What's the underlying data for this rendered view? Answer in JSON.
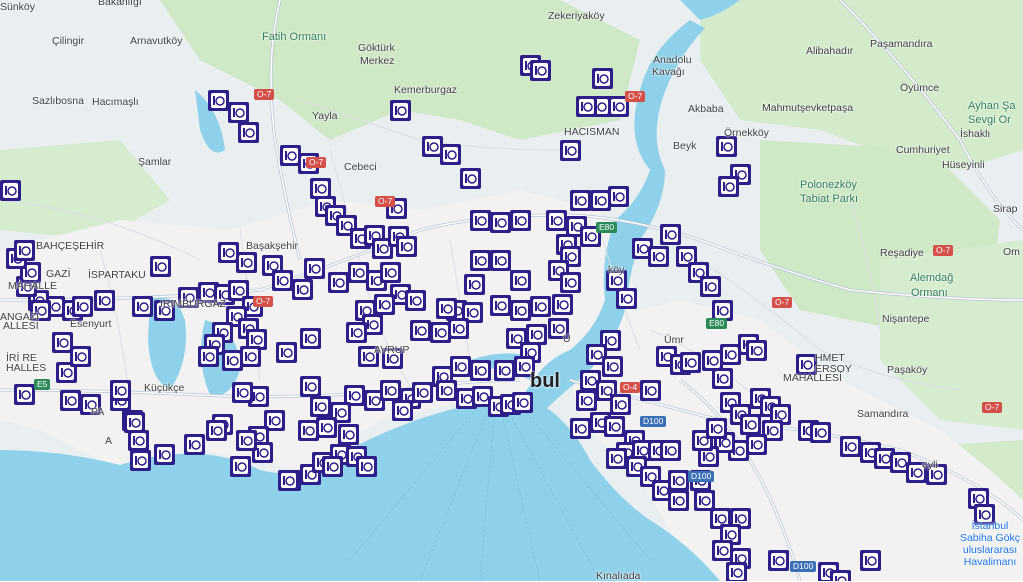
{
  "map": {
    "colors": {
      "land": "#e9eef0",
      "forest": "#cfe8c5",
      "water": "#8fd1ea",
      "urban": "#f3f3f3",
      "marker": "#2c1f8a"
    },
    "places": [
      {
        "id": "sunkoy",
        "text": "Sünköy",
        "cls": "place"
      },
      {
        "id": "bakanligi",
        "text": "Bakanlığı",
        "cls": "place"
      },
      {
        "id": "cilingir",
        "text": "Çilingir",
        "cls": "place"
      },
      {
        "id": "arnavutkoy",
        "text": "Arnavutköy",
        "cls": "place"
      },
      {
        "id": "fatih-ormani",
        "text": "Fatih Ormanı",
        "cls": "place green"
      },
      {
        "id": "gokturk",
        "text": "Göktürk",
        "cls": "place"
      },
      {
        "id": "merkez",
        "text": "Merkez",
        "cls": "place"
      },
      {
        "id": "zekeriyakoy",
        "text": "Zekeriyaköy",
        "cls": "place"
      },
      {
        "id": "anadolu-kavagi",
        "text": "Anadolu",
        "cls": "place"
      },
      {
        "id": "kavagi",
        "text": "Kavağı",
        "cls": "place"
      },
      {
        "id": "alibahadir",
        "text": "Alibahadır",
        "cls": "place"
      },
      {
        "id": "pasamandira",
        "text": "Paşamandıra",
        "cls": "place"
      },
      {
        "id": "sazlibosna",
        "text": "Sazlıbosna",
        "cls": "place"
      },
      {
        "id": "hacimasli",
        "text": "Hacımaşlı",
        "cls": "place"
      },
      {
        "id": "kemerburgaz",
        "text": "Kemerburgaz",
        "cls": "place"
      },
      {
        "id": "akbaba",
        "text": "Akbaba",
        "cls": "place"
      },
      {
        "id": "mahmutsevketpasa",
        "text": "Mahmutşevketpaşa",
        "cls": "place"
      },
      {
        "id": "oyumce",
        "text": "Öyümce",
        "cls": "place"
      },
      {
        "id": "ayhan-sa",
        "text": "Ayhan Şa",
        "cls": "place green"
      },
      {
        "id": "sevgi-or",
        "text": "Sevgi Or",
        "cls": "place green"
      },
      {
        "id": "ishakli",
        "text": "İshaklı",
        "cls": "place"
      },
      {
        "id": "yayla",
        "text": "Yayla",
        "cls": "place"
      },
      {
        "id": "hacisman",
        "text": "HACISMAN",
        "cls": "place"
      },
      {
        "id": "beyk",
        "text": "Beyk",
        "cls": "place"
      },
      {
        "id": "ornekkoy",
        "text": "Örnekköy",
        "cls": "place"
      },
      {
        "id": "cumhuriyet",
        "text": "Cumhuriyet",
        "cls": "place"
      },
      {
        "id": "huseyinli",
        "text": "Hüseyinli",
        "cls": "place"
      },
      {
        "id": "samlar",
        "text": "Şamlar",
        "cls": "place"
      },
      {
        "id": "cebeci",
        "text": "Cebeci",
        "cls": "place"
      },
      {
        "id": "polonezkoy",
        "text": "Polonezköy",
        "cls": "place green"
      },
      {
        "id": "tabiat-parki",
        "text": "Tabiat Parkı",
        "cls": "place green"
      },
      {
        "id": "sirap",
        "text": "Sirap",
        "cls": "place"
      },
      {
        "id": "bahcesehir",
        "text": "BAHÇEŞEHİR",
        "cls": "place"
      },
      {
        "id": "basaksehir",
        "text": "Başakşehir",
        "cls": "place"
      },
      {
        "id": "resadiye",
        "text": "Reşadiye",
        "cls": "place"
      },
      {
        "id": "om",
        "text": "Om",
        "cls": "place"
      },
      {
        "id": "gazi",
        "text": "GAZİ",
        "cls": "place"
      },
      {
        "id": "mahalle-1",
        "text": "MAHALLE",
        "cls": "place"
      },
      {
        "id": "ispartakule",
        "text": "İSPARTAKU",
        "cls": "place"
      },
      {
        "id": "karakoy",
        "text": "köy",
        "cls": "place"
      },
      {
        "id": "alemdag",
        "text": "Alemdağ",
        "cls": "place green"
      },
      {
        "id": "ormani",
        "text": "Ormanı",
        "cls": "place green"
      },
      {
        "id": "dirimburgaz",
        "text": "IRIMBURGAZ",
        "cls": "place"
      },
      {
        "id": "angazi",
        "text": "ANGAZİ",
        "cls": "place"
      },
      {
        "id": "mahallesi-1",
        "text": "ALLESİ",
        "cls": "place"
      },
      {
        "id": "esenyurt",
        "text": "Esenyurt",
        "cls": "place"
      },
      {
        "id": "nisantepe",
        "text": "Nişantepe",
        "cls": "place"
      },
      {
        "id": "ahmet",
        "text": "HMET",
        "cls": "place"
      },
      {
        "id": "ersoy",
        "text": "ERSOY",
        "cls": "place"
      },
      {
        "id": "mahallesi-2",
        "text": "MAHALLESİ",
        "cls": "place"
      },
      {
        "id": "birires",
        "text": "İRİ RE",
        "cls": "place"
      },
      {
        "id": "halles",
        "text": "HALLES",
        "cls": "place"
      },
      {
        "id": "avrup",
        "text": "AVRUP",
        "cls": "place"
      },
      {
        "id": "uskudar",
        "text": "Ü",
        "cls": "place"
      },
      {
        "id": "umr",
        "text": "Ümr",
        "cls": "place"
      },
      {
        "id": "kucukce",
        "text": "Küçükçe",
        "cls": "place"
      },
      {
        "id": "istanbul",
        "text": "bul",
        "cls": "place big"
      },
      {
        "id": "pasakoy",
        "text": "Paşaköy",
        "cls": "place"
      },
      {
        "id": "pa",
        "text": "PA",
        "cls": "place"
      },
      {
        "id": "samandira",
        "text": "Samandıra",
        "cls": "place"
      },
      {
        "id": "a",
        "text": "A",
        "cls": "place"
      },
      {
        "id": "eyli",
        "text": "eyli",
        "cls": "place"
      },
      {
        "id": "kinaliada",
        "text": "Kınalıada",
        "cls": "place"
      },
      {
        "id": "sabiha",
        "text": "İstanbul Sabiha Gökç uluslararası Havalimanı",
        "cls": "place airport"
      }
    ],
    "shields": [
      {
        "id": "o7-a",
        "text": "O-7",
        "color": "red"
      },
      {
        "id": "o7-b",
        "text": "O-7",
        "color": "red"
      },
      {
        "id": "o7-c",
        "text": "O-7",
        "color": "red"
      },
      {
        "id": "o7-d",
        "text": "O-7",
        "color": "red"
      },
      {
        "id": "o7-e",
        "text": "O-7",
        "color": "red"
      },
      {
        "id": "o7-f",
        "text": "O-7",
        "color": "red"
      },
      {
        "id": "o7-g",
        "text": "O-7",
        "color": "red"
      },
      {
        "id": "o7-h",
        "text": "O-7",
        "color": "red"
      },
      {
        "id": "e80-a",
        "text": "E80",
        "color": "green"
      },
      {
        "id": "e80-b",
        "text": "E80",
        "color": "green"
      },
      {
        "id": "e5",
        "text": "E5",
        "color": "green"
      },
      {
        "id": "d100-a",
        "text": "D100",
        "color": "blue"
      },
      {
        "id": "d100-b",
        "text": "D100",
        "color": "blue"
      },
      {
        "id": "d100-c",
        "text": "D100",
        "color": "blue"
      },
      {
        "id": "o4",
        "text": "O-4",
        "color": "red"
      }
    ],
    "marker_icon": "speed-camera-icon"
  }
}
